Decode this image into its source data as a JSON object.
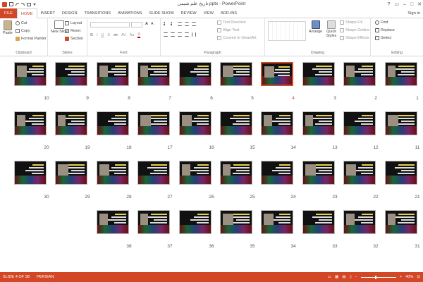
{
  "app": {
    "title": "تاریخ علم شیمی.pptx - PowerPoint",
    "signin": "Sign in",
    "quick_access": [
      "ppt-logo-icon",
      "save-icon",
      "undo-icon",
      "redo-icon",
      "start-slideshow-icon",
      "customize-icon"
    ]
  },
  "tabs": [
    "FILE",
    "HOME",
    "INSERT",
    "DESIGN",
    "TRANSITIONS",
    "ANIMATIONS",
    "SLIDE SHOW",
    "REVIEW",
    "VIEW",
    "ADD-INS"
  ],
  "active_tab": "HOME",
  "ribbon": {
    "clipboard": {
      "label": "Clipboard",
      "paste": "Paste",
      "cut": "Cut",
      "copy": "Copy",
      "format_painter": "Format Painter"
    },
    "slides": {
      "label": "Slides",
      "new_slide": "New Slide",
      "layout": "Layout",
      "reset": "Reset",
      "section": "Section"
    },
    "font": {
      "label": "Font"
    },
    "paragraph": {
      "label": "Paragraph",
      "text_direction": "Text Direction",
      "align_text": "Align Text",
      "convert": "Convert to SmartArt"
    },
    "drawing": {
      "label": "Drawing",
      "arrange": "Arrange",
      "quick_styles": "Quick Styles",
      "shape_fill": "Shape Fill",
      "shape_outline": "Shape Outline",
      "shape_effects": "Shape Effects"
    },
    "editing": {
      "label": "Editing",
      "find": "Find",
      "replace": "Replace",
      "select": "Select"
    }
  },
  "slides": {
    "selected": 4,
    "rows": [
      [
        10,
        9,
        8,
        7,
        6,
        5,
        4,
        3,
        2,
        1
      ],
      [
        20,
        19,
        18,
        17,
        16,
        15,
        14,
        13,
        12,
        11
      ],
      [
        30,
        29,
        28,
        27,
        26,
        25,
        24,
        23,
        22,
        21
      ],
      [
        38,
        37,
        36,
        35,
        34,
        33,
        32,
        31
      ]
    ]
  },
  "status": {
    "slide_info": "SLIDE 4 OF 38",
    "language": "PERSIAN",
    "zoom": "40%"
  },
  "colors": {
    "accent": "#d24726",
    "slide_bg": "#111111",
    "title_yellow": "#e8d24a"
  }
}
